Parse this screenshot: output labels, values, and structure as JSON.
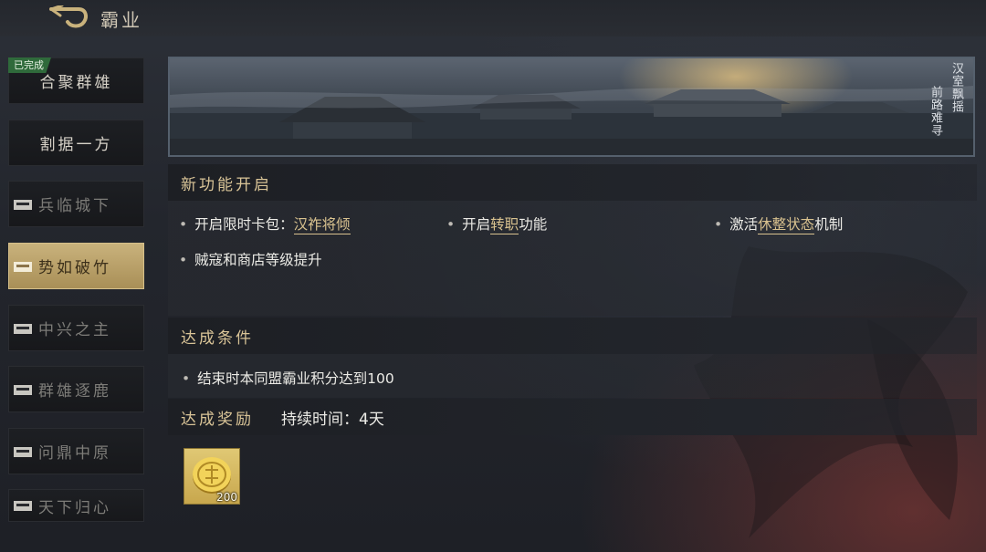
{
  "header": {
    "title": "霸业"
  },
  "sidebar": {
    "items": [
      {
        "label": "合聚群雄",
        "state": "done",
        "badge": "已完成"
      },
      {
        "label": "割据一方",
        "state": "open"
      },
      {
        "label": "兵临城下",
        "state": "locked"
      },
      {
        "label": "势如破竹",
        "state": "locked",
        "selected": true
      },
      {
        "label": "中兴之主",
        "state": "locked"
      },
      {
        "label": "群雄逐鹿",
        "state": "locked"
      },
      {
        "label": "问鼎中原",
        "state": "locked"
      },
      {
        "label": "天下归心",
        "state": "locked"
      }
    ]
  },
  "banner": {
    "poem_col1": "汉室飘摇",
    "poem_col2": "前路难寻"
  },
  "features": {
    "title": "新功能开启",
    "items": [
      {
        "pre": "开启限时卡包：",
        "highlight": "汉祚将倾",
        "post": ""
      },
      {
        "pre": "开启",
        "highlight": "转职",
        "post": "功能"
      },
      {
        "pre": "激活",
        "highlight": "休整状态",
        "post": "机制"
      },
      {
        "pre": "贼寇和商店等级提升",
        "highlight": "",
        "post": ""
      }
    ]
  },
  "conditions": {
    "title": "达成条件",
    "items": [
      "结束时本同盟霸业积分达到100"
    ]
  },
  "rewards": {
    "title": "达成奖励",
    "duration": "持续时间：4天",
    "items": [
      {
        "icon": "gold-coin-icon",
        "count": "200"
      }
    ]
  },
  "colors": {
    "accent_gold": "#d9c28f",
    "selected_tab": "#c9b27c",
    "done_badge": "#2f6a3b"
  }
}
